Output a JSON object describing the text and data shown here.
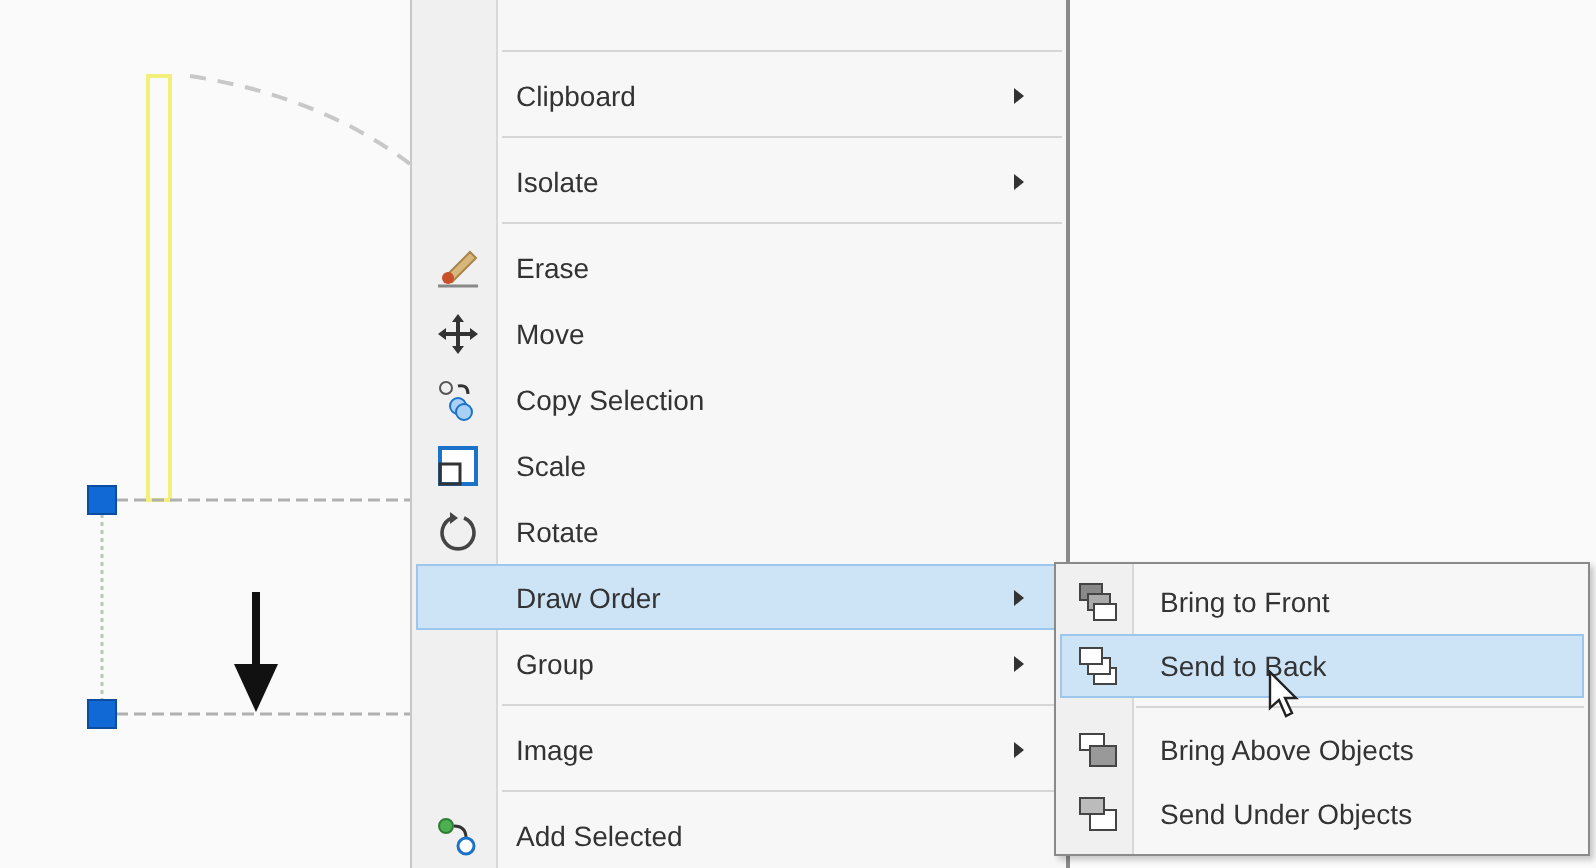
{
  "context_menu": {
    "items": [
      {
        "kind": "separator"
      },
      {
        "kind": "item",
        "label": "Clipboard",
        "submenu": true,
        "selected": false
      },
      {
        "kind": "separator"
      },
      {
        "kind": "item",
        "label": "Isolate",
        "submenu": true,
        "selected": false
      },
      {
        "kind": "separator"
      },
      {
        "kind": "item",
        "label": "Erase",
        "submenu": false,
        "selected": false
      },
      {
        "kind": "item",
        "label": "Move",
        "submenu": false,
        "selected": false
      },
      {
        "kind": "item",
        "label": "Copy Selection",
        "submenu": false,
        "selected": false
      },
      {
        "kind": "item",
        "label": "Scale",
        "submenu": false,
        "selected": false
      },
      {
        "kind": "item",
        "label": "Rotate",
        "submenu": false,
        "selected": false
      },
      {
        "kind": "item",
        "label": "Draw Order",
        "submenu": true,
        "selected": true
      },
      {
        "kind": "item",
        "label": "Group",
        "submenu": true,
        "selected": false
      },
      {
        "kind": "separator"
      },
      {
        "kind": "item",
        "label": "Image",
        "submenu": true,
        "selected": false
      },
      {
        "kind": "separator"
      },
      {
        "kind": "item",
        "label": "Add Selected",
        "submenu": false,
        "selected": false
      }
    ]
  },
  "submenu": {
    "items": [
      {
        "kind": "item",
        "label": "Bring to Front",
        "selected": false
      },
      {
        "kind": "item",
        "label": "Send to Back",
        "selected": true
      },
      {
        "kind": "separator"
      },
      {
        "kind": "item",
        "label": "Bring Above Objects",
        "selected": false
      },
      {
        "kind": "item",
        "label": "Send Under Objects",
        "selected": false
      }
    ]
  }
}
